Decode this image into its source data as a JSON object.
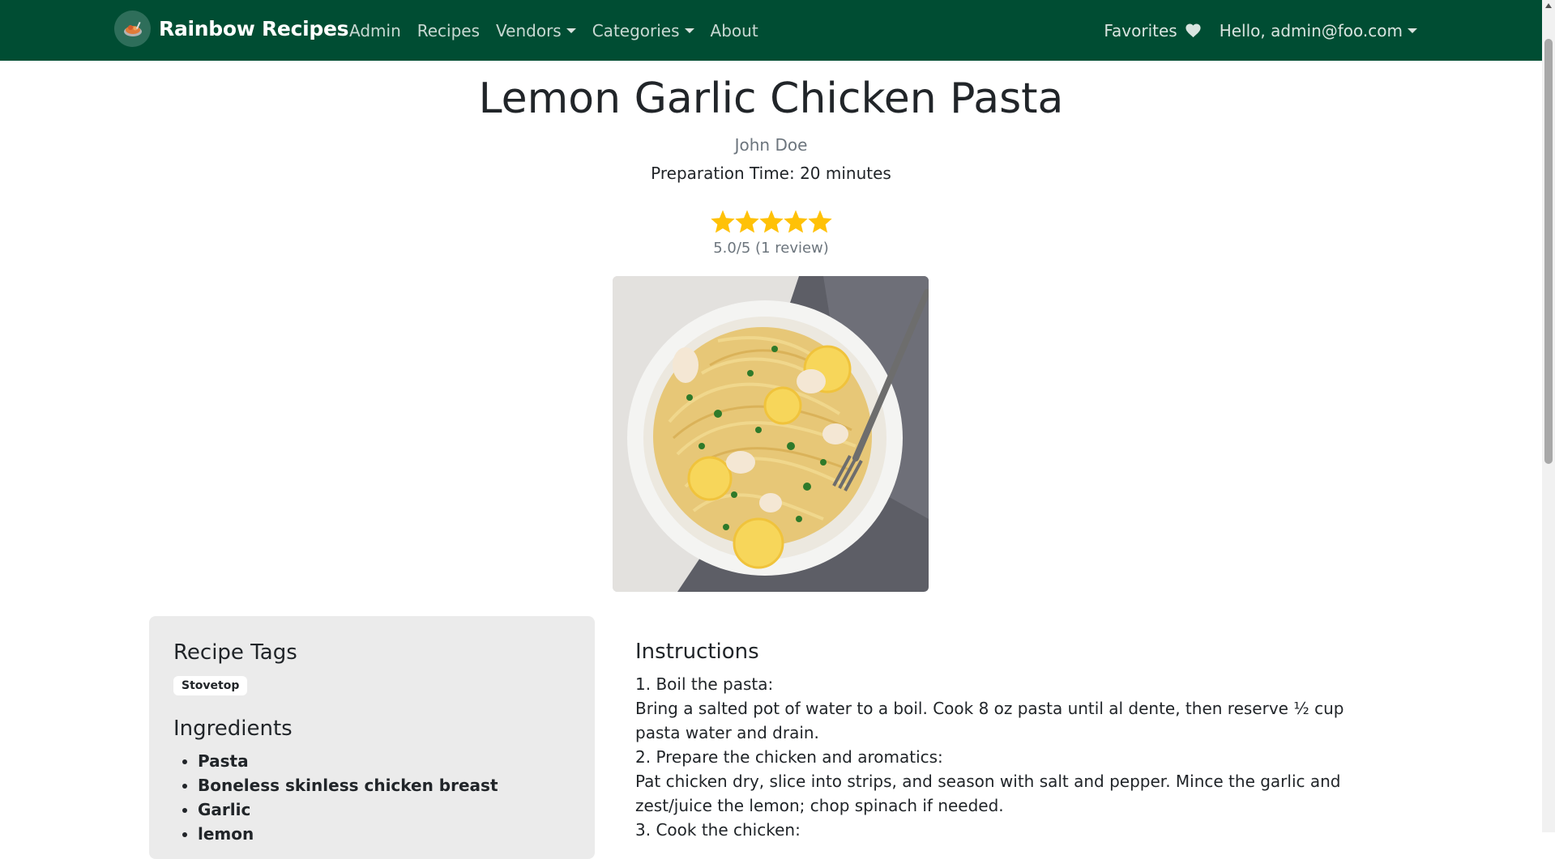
{
  "navbar": {
    "brand": "Rainbow Recipes",
    "links": [
      "Admin",
      "Recipes",
      "Vendors",
      "Categories",
      "About"
    ],
    "favorites": "Favorites",
    "user_menu": "Hello, admin@foo.com",
    "background": "#004d33"
  },
  "recipe": {
    "title": "Lemon Garlic Chicken Pasta",
    "author": "John Doe",
    "prep_time": "Preparation Time: 20 minutes",
    "rating": 5.0,
    "rating_text": "5.0/5 (1 review)"
  },
  "tags": {
    "heading": "Recipe Tags",
    "items": [
      "Stovetop"
    ]
  },
  "ingredients": {
    "heading": "Ingredients",
    "items": [
      "Pasta",
      "Boneless skinless chicken breast",
      "Garlic",
      "lemon"
    ]
  },
  "instructions": {
    "heading": "Instructions",
    "lines": [
      "1. Boil the pasta:",
      "Bring a salted pot of water to a boil. Cook 8 oz pasta until al dente, then reserve ½ cup pasta water and drain.",
      "2. Prepare the chicken and aromatics:",
      "Pat chicken dry, slice into strips, and season with salt and pepper. Mince the garlic and zest/juice the lemon; chop spinach if needed.",
      "3. Cook the chicken:"
    ]
  },
  "colors": {
    "star": "#ffc107",
    "card_bg": "#ebebeb"
  }
}
